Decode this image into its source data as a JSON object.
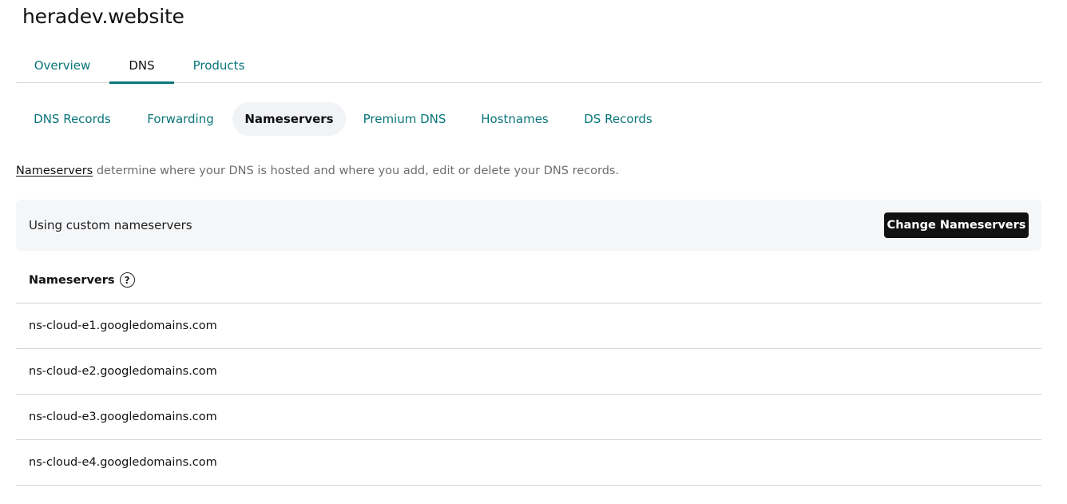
{
  "domain": {
    "title": "heradev.website"
  },
  "primary_tabs": [
    {
      "label": "Overview"
    },
    {
      "label": "DNS",
      "active": true
    },
    {
      "label": "Products"
    }
  ],
  "sub_tabs": [
    {
      "label": "DNS Records"
    },
    {
      "label": "Forwarding"
    },
    {
      "label": "Nameservers",
      "active": true
    },
    {
      "label": "Premium DNS"
    },
    {
      "label": "Hostnames"
    },
    {
      "label": "DS Records"
    }
  ],
  "description": {
    "link_text": "Nameservers",
    "text": " determine where your DNS is hosted and where you add, edit or delete your DNS records."
  },
  "status": {
    "text": "Using custom nameservers",
    "button_label": "Change Nameservers"
  },
  "nameservers": {
    "header": "Nameservers",
    "help_icon": "question-circle-icon",
    "help_glyph": "?",
    "items": [
      "ns-cloud-e1.googledomains.com",
      "ns-cloud-e2.googledomains.com",
      "ns-cloud-e3.googledomains.com",
      "ns-cloud-e4.googledomains.com"
    ]
  },
  "colors": {
    "accent": "#09757a",
    "button_bg": "#111111",
    "panel_bg": "#f5f6f8",
    "active_pill_bg": "#f1f3f6"
  }
}
